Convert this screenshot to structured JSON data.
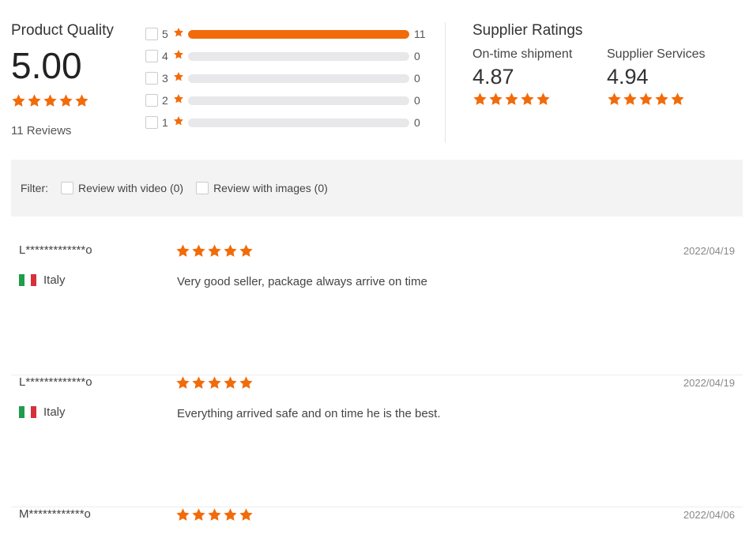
{
  "colors": {
    "accent": "#f26b0a",
    "flag_green": "#1e9d4b",
    "flag_white": "#ffffff",
    "flag_red": "#d6313b"
  },
  "product_quality": {
    "title": "Product Quality",
    "score": "5.00",
    "stars": 5,
    "reviews_label": "11 Reviews"
  },
  "distribution": [
    {
      "stars": "5",
      "count": "11",
      "fraction": 1.0
    },
    {
      "stars": "4",
      "count": "0",
      "fraction": 0
    },
    {
      "stars": "3",
      "count": "0",
      "fraction": 0
    },
    {
      "stars": "2",
      "count": "0",
      "fraction": 0
    },
    {
      "stars": "1",
      "count": "0",
      "fraction": 0
    }
  ],
  "supplier": {
    "title": "Supplier Ratings",
    "metrics": [
      {
        "label": "On-time shipment",
        "value": "4.87",
        "stars": 5
      },
      {
        "label": "Supplier Services",
        "value": "4.94",
        "stars": 5
      }
    ]
  },
  "filter": {
    "label": "Filter:",
    "options": [
      {
        "label": "Review with video (0)"
      },
      {
        "label": "Review with images (0)"
      }
    ]
  },
  "reviews": [
    {
      "user": "L*************o",
      "country": "Italy",
      "stars": 5,
      "date": "2022/04/19",
      "text": "Very good seller, package always arrive on time"
    },
    {
      "user": "L*************o",
      "country": "Italy",
      "stars": 5,
      "date": "2022/04/19",
      "text": "Everything arrived safe and on time he is the best."
    },
    {
      "user": "M************o",
      "country": "",
      "stars": 5,
      "date": "2022/04/06",
      "text": ""
    }
  ]
}
